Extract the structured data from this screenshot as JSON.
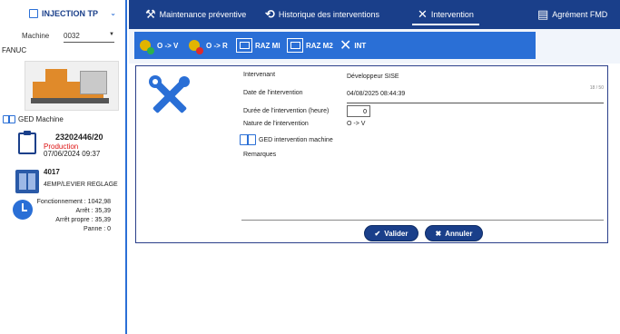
{
  "sidebar": {
    "title": "INJECTION TP",
    "machine_label": "Machine",
    "machine_value": "0032",
    "brand": "FANUC",
    "ged_machine_label": "GED Machine",
    "of_number": "23202446/20",
    "of_status": "Production",
    "of_date": "07/06/2024 09:37",
    "mold_code": "4017",
    "mold_name": "4EMP/LEVIER REGLAGE",
    "stats": [
      "Fonctionnement : 1042,98",
      "Arrêt : 35,39",
      "Arrêt propre : 35,39",
      "Panne : 0"
    ]
  },
  "topbar": {
    "tabs": [
      {
        "label": "Maintenance préventive",
        "icon": "tools-icon"
      },
      {
        "label": "Historique des interventions",
        "icon": "history-icon"
      },
      {
        "label": "Intervention",
        "icon": "tools-icon"
      },
      {
        "label": "Agrément FMD",
        "icon": "document-icon"
      }
    ]
  },
  "subbar": {
    "items": [
      {
        "label": "O -> V",
        "icon": "gear-green-icon"
      },
      {
        "label": "O -> R",
        "icon": "gear-red-icon"
      },
      {
        "label": "RAZ MI",
        "icon": "reset-counter-icon"
      },
      {
        "label": "RAZ M2",
        "icon": "reset-counter-icon"
      },
      {
        "label": "INT",
        "icon": "tools-icon"
      }
    ]
  },
  "form": {
    "intervenant_label": "Intervenant",
    "intervenant_value": "Développeur SISE",
    "date_label": "Date de l'intervention",
    "date_value": "04/08/2025 08:44:39",
    "counter": "18 / 50",
    "duration_label": "Durée de l'intervention (heure)",
    "duration_value": "0",
    "nature_label": "Nature de l'intervention",
    "nature_value": "O -> V",
    "ged_intervention_label": "GED intervention machine",
    "remarks_label": "Remarques",
    "validate_label": "Valider",
    "cancel_label": "Annuler"
  },
  "colors": {
    "primary_dark": "#1a3f8a",
    "primary": "#2a6fd6",
    "status_red": "#dd1111"
  }
}
